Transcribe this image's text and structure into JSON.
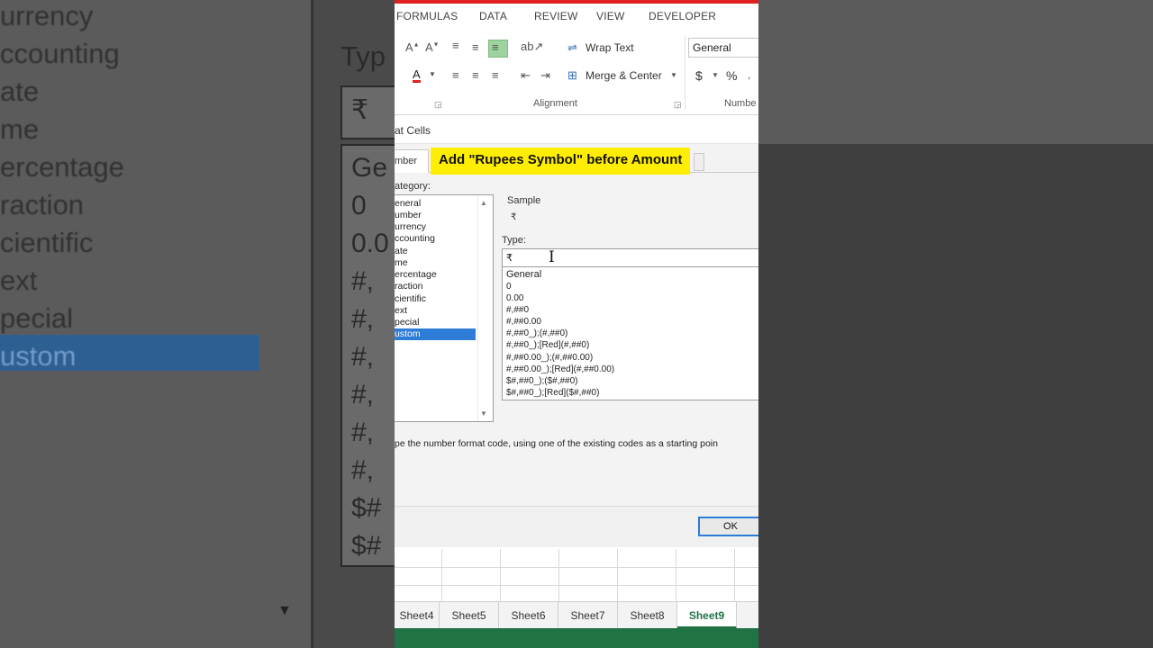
{
  "background": {
    "categories": [
      "urrency",
      "ccounting",
      "ate",
      "me",
      "ercentage",
      "raction",
      "cientific",
      "ext",
      "pecial",
      "ustom"
    ],
    "type_label": "Typ",
    "type_value": "₹",
    "list_items": [
      "Ge",
      "0",
      "0.0",
      "#,",
      "#,",
      "#,",
      "#,",
      "#,",
      "#,",
      "$#",
      "$#"
    ]
  },
  "ribbon": {
    "tabs": [
      "FORMULAS",
      "DATA",
      "REVIEW",
      "VIEW",
      "DEVELOPER"
    ],
    "wrap_text": "Wrap Text",
    "merge_center": "Merge & Center",
    "number_format": "General",
    "alignment_group": "Alignment",
    "number_group": "Numbe",
    "currency_symbol": "$",
    "percent_symbol": "%"
  },
  "dialog": {
    "title": "at Cells",
    "tab_number": "mber",
    "banner": "Add \"Rupees Symbol\" before Amount",
    "category_label": "ategory:",
    "categories": [
      "eneral",
      "umber",
      "urrency",
      "ccounting",
      "ate",
      "me",
      "ercentage",
      "raction",
      "cientific",
      "ext",
      "pecial",
      "ustom"
    ],
    "selected_category": "ustom",
    "sample_label": "Sample",
    "sample_value": "₹",
    "type_label": "Type:",
    "type_value": "₹",
    "type_list": [
      "General",
      "0",
      "0.00",
      "#,##0",
      "#,##0.00",
      "#,##0_);(#,##0)",
      "#,##0_);[Red](#,##0)",
      "#,##0.00_);(#,##0.00)",
      "#,##0.00_);[Red](#,##0.00)",
      "$#,##0_);($#,##0)",
      "$#,##0_);[Red]($#,##0)"
    ],
    "hint": "pe the number format code, using one of the existing codes as a starting poin",
    "ok_label": "OK"
  },
  "sheets": [
    "Sheet4",
    "Sheet5",
    "Sheet6",
    "Sheet7",
    "Sheet8",
    "Sheet9"
  ],
  "active_sheet": "Sheet9",
  "colors": {
    "accent_green": "#217346",
    "selection_blue": "#2d7cd6",
    "banner_yellow": "#ffee00",
    "title_red": "#e02020"
  }
}
